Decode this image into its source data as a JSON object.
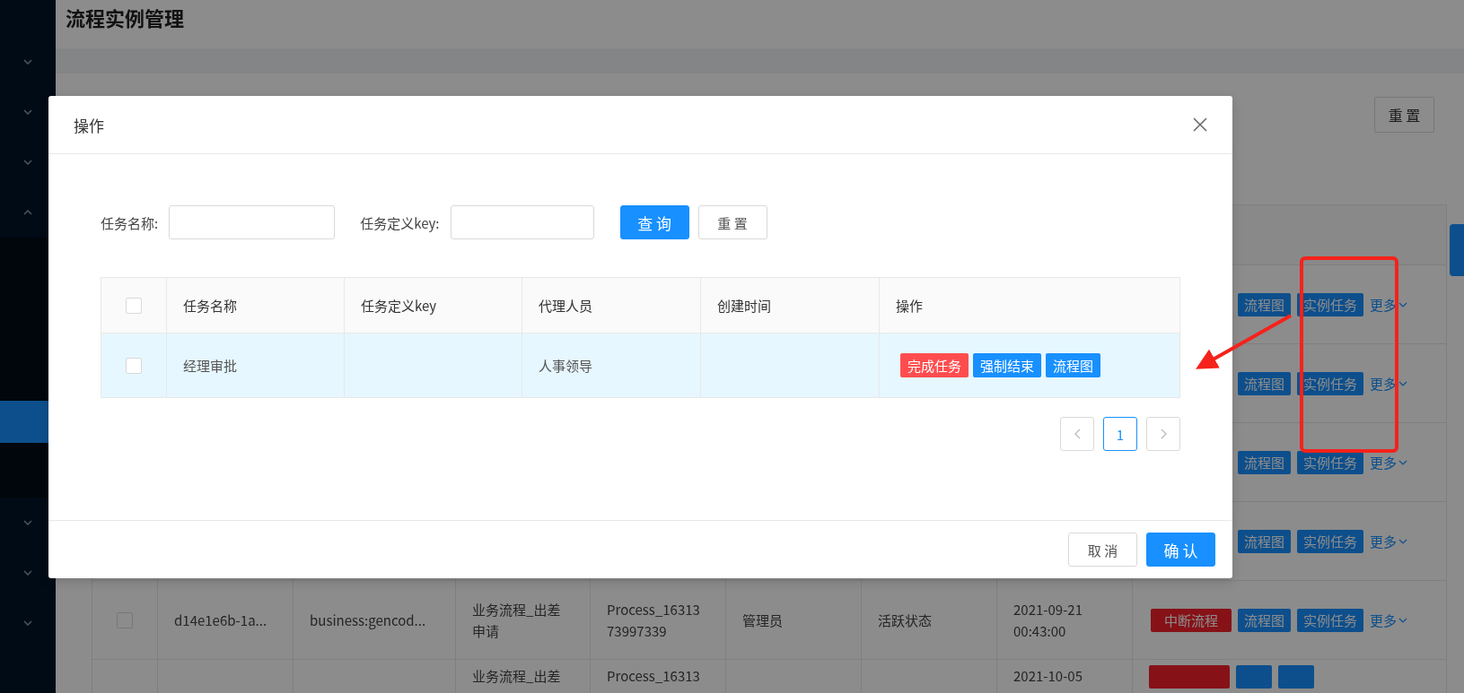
{
  "sidebar": {
    "items": [
      {
        "expanded": false
      },
      {
        "expanded": false
      },
      {
        "expanded": false
      },
      {
        "expanded": true,
        "children": [
          {
            "selected": false
          },
          {
            "selected": false
          },
          {
            "selected": false
          },
          {
            "selected": false
          },
          {
            "selected": true
          },
          {
            "selected": false
          }
        ]
      },
      {
        "expanded": false
      },
      {
        "expanded": false
      },
      {
        "expanded": false
      }
    ]
  },
  "page": {
    "title": "流程实例管理",
    "reset_button": "重 置"
  },
  "table": {
    "rows": [
      {
        "actions": [
          {
            "kind": "primary",
            "label": "流程图"
          },
          {
            "kind": "primary",
            "label": "实例任务"
          },
          {
            "kind": "link",
            "label": "更多"
          }
        ]
      },
      {
        "actions": [
          {
            "kind": "primary",
            "label": "流程图"
          },
          {
            "kind": "primary",
            "label": "实例任务"
          },
          {
            "kind": "link",
            "label": "更多"
          }
        ]
      },
      {
        "actions": [
          {
            "kind": "primary",
            "label": "流程图"
          },
          {
            "kind": "primary",
            "label": "实例任务"
          },
          {
            "kind": "link",
            "label": "更多"
          }
        ]
      },
      {
        "actions": [
          {
            "kind": "primary",
            "label": "流程图"
          },
          {
            "kind": "primary",
            "label": "实例任务"
          },
          {
            "kind": "link",
            "label": "更多"
          }
        ]
      },
      {
        "checked": false,
        "cells": [
          "d14e1e6b-1a...",
          "business:gencod...",
          "业务流程_出差申请",
          "Process_1631373997339",
          "管理员",
          "活跃状态",
          "2021-09-21\n00:43:00"
        ],
        "actions": [
          {
            "kind": "danger",
            "label": "中断流程"
          },
          {
            "kind": "primary",
            "label": "流程图"
          },
          {
            "kind": "primary",
            "label": "实例任务"
          },
          {
            "kind": "link",
            "label": "更多"
          }
        ]
      },
      {
        "cells": [
          "",
          "",
          "业务流程_出差",
          "Process_16313",
          "",
          "",
          "2021-10-05"
        ],
        "actions": [
          {
            "kind": "danger"
          },
          {
            "kind": "primary"
          },
          {
            "kind": "primary"
          }
        ]
      }
    ]
  },
  "dialog": {
    "title": "操作",
    "filters": [
      {
        "label": "任务名称:"
      },
      {
        "label": "任务定义key:"
      }
    ],
    "search_button": "查 询",
    "reset_button": "重 置",
    "columns": [
      "任务名称",
      "任务定义key",
      "代理人员",
      "创建时间",
      "操作"
    ],
    "header_checked": false,
    "rows": [
      {
        "checked": false,
        "hovered": true,
        "cells": [
          "经理审批",
          "",
          "人事领导",
          ""
        ],
        "actions": [
          {
            "kind": "danger",
            "label": "完成任务"
          },
          {
            "kind": "primary",
            "label": "强制结束"
          },
          {
            "kind": "primary",
            "label": "流程图"
          }
        ]
      }
    ],
    "pagination": {
      "pages": [
        {
          "label": "1",
          "selected": true
        }
      ]
    },
    "cancel_button": "取 消",
    "ok_button": "确 认"
  }
}
